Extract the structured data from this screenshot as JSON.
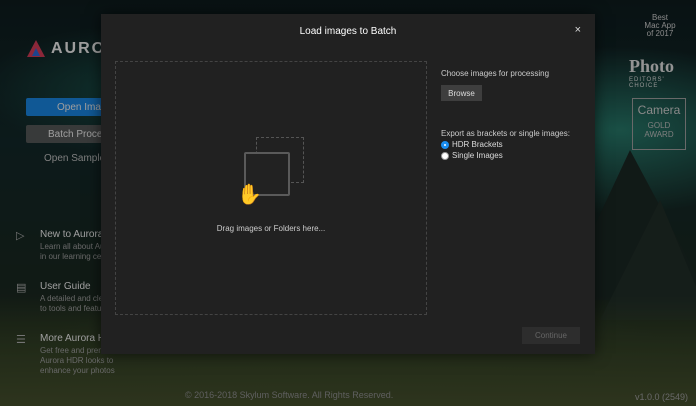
{
  "app": {
    "logo_text": "AURORA",
    "open_image_label": "Open Imag",
    "batch_process_label": "Batch Process",
    "open_sample_label": "Open Sample I",
    "items": [
      {
        "title": "New to Aurora I",
        "desc": "Learn all about Aur\nin our learning cen"
      },
      {
        "title": "User Guide",
        "desc": "A detailed and clea\nto tools and featur"
      },
      {
        "title": "More Aurora HL",
        "desc": "Get free and prem\nAurora HDR looks to\nenhance your photos"
      }
    ],
    "copyright": "© 2016-2018 Skylum Software. All Rights Reserved.",
    "version": "v1.0.0 (2549)"
  },
  "awards": {
    "mac_app": "Best\nMac App\nof 2017",
    "photo_logo": "Photo",
    "photo_sub": "EDITORS' CHOICE",
    "camera_title": "Camera",
    "camera_award": "GOLD\nAWARD"
  },
  "modal": {
    "title": "Load images to Batch",
    "close": "×",
    "drop_text": "Drag images or Folders here...",
    "choose_label": "Choose images for processing",
    "browse_label": "Browse",
    "export_label": "Export as brackets or single images:",
    "options": [
      {
        "label": "HDR Brackets",
        "selected": true
      },
      {
        "label": "Single Images",
        "selected": false
      }
    ],
    "continue_label": "Continue"
  }
}
